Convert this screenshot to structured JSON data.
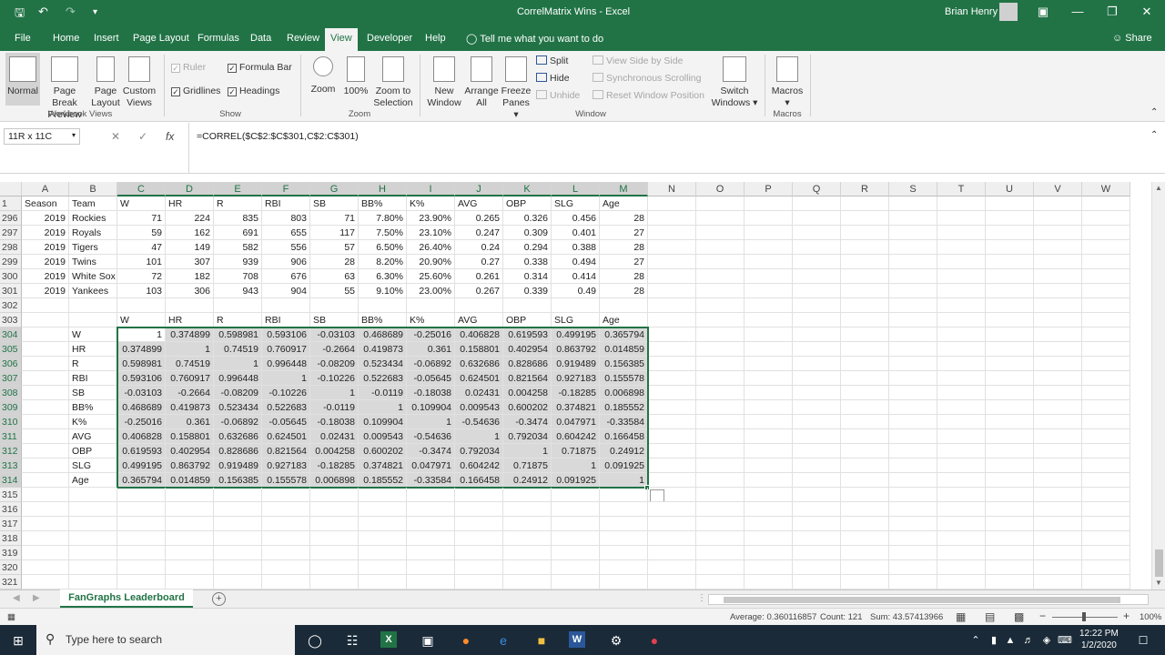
{
  "window": {
    "title": "CorrelMatrix Wins  -  Excel",
    "user": "Brian Henry"
  },
  "tabs": [
    "File",
    "Home",
    "Insert",
    "Page Layout",
    "Formulas",
    "Data",
    "Review",
    "View",
    "Developer",
    "Help"
  ],
  "active_tab": "View",
  "tell_me": "Tell me what you want to do",
  "share": "Share",
  "ribbon": {
    "workbook_views": {
      "group": "Workbook Views",
      "normal": "Normal",
      "page_break": "Page Break Preview",
      "page_layout": "Page Layout",
      "custom_views": "Custom Views"
    },
    "show": {
      "group": "Show",
      "ruler": "Ruler",
      "formula_bar": "Formula Bar",
      "gridlines": "Gridlines",
      "headings": "Headings"
    },
    "zoom": {
      "group": "Zoom",
      "zoom": "Zoom",
      "hundred": "100%",
      "zoom_sel": "Zoom to Selection"
    },
    "window": {
      "group": "Window",
      "new_window": "New Window",
      "arrange_all": "Arrange All",
      "freeze_panes": "Freeze Panes",
      "split": "Split",
      "hide": "Hide",
      "unhide": "Unhide",
      "side_by_side": "View Side by Side",
      "sync_scroll": "Synchronous Scrolling",
      "reset_pos": "Reset Window Position",
      "switch_windows": "Switch Windows"
    },
    "macros": {
      "group": "Macros",
      "macros": "Macros"
    }
  },
  "formula_bar": {
    "name_box": "11R x 11C",
    "formula": "=CORREL($C$2:$C$301,C$2:C$301)"
  },
  "columns": [
    "A",
    "B",
    "C",
    "D",
    "E",
    "F",
    "G",
    "H",
    "I",
    "J",
    "K",
    "L",
    "M",
    "N",
    "O",
    "P",
    "Q",
    "R",
    "S",
    "T",
    "U",
    "V",
    "W"
  ],
  "header_row": {
    "num": "1",
    "cells": [
      "Season",
      "Team",
      "W",
      "HR",
      "R",
      "RBI",
      "SB",
      "BB%",
      "K%",
      "AVG",
      "OBP",
      "SLG",
      "Age"
    ]
  },
  "data_rows": [
    {
      "num": "296",
      "cells": [
        "2019",
        "Rockies",
        "71",
        "224",
        "835",
        "803",
        "71",
        "7.80%",
        "23.90%",
        "0.265",
        "0.326",
        "0.456",
        "28"
      ]
    },
    {
      "num": "297",
      "cells": [
        "2019",
        "Royals",
        "59",
        "162",
        "691",
        "655",
        "117",
        "7.50%",
        "23.10%",
        "0.247",
        "0.309",
        "0.401",
        "27"
      ]
    },
    {
      "num": "298",
      "cells": [
        "2019",
        "Tigers",
        "47",
        "149",
        "582",
        "556",
        "57",
        "6.50%",
        "26.40%",
        "0.24",
        "0.294",
        "0.388",
        "28"
      ]
    },
    {
      "num": "299",
      "cells": [
        "2019",
        "Twins",
        "101",
        "307",
        "939",
        "906",
        "28",
        "8.20%",
        "20.90%",
        "0.27",
        "0.338",
        "0.494",
        "27"
      ]
    },
    {
      "num": "300",
      "cells": [
        "2019",
        "White Sox",
        "72",
        "182",
        "708",
        "676",
        "63",
        "6.30%",
        "25.60%",
        "0.261",
        "0.314",
        "0.414",
        "28"
      ]
    },
    {
      "num": "301",
      "cells": [
        "2019",
        "Yankees",
        "103",
        "306",
        "943",
        "904",
        "55",
        "9.10%",
        "23.00%",
        "0.267",
        "0.339",
        "0.49",
        "28"
      ]
    }
  ],
  "blank_row_302": "302",
  "matrix_header_row": {
    "num": "303",
    "cells": [
      "",
      "",
      "W",
      "HR",
      "R",
      "RBI",
      "SB",
      "BB%",
      "K%",
      "AVG",
      "OBP",
      "SLG",
      "Age"
    ]
  },
  "matrix_rows": [
    {
      "num": "304",
      "label": "W",
      "values": [
        "1",
        "0.374899",
        "0.598981",
        "0.593106",
        "-0.03103",
        "0.468689",
        "-0.25016",
        "0.406828",
        "0.619593",
        "0.499195",
        "0.365794"
      ]
    },
    {
      "num": "305",
      "label": "HR",
      "values": [
        "0.374899",
        "1",
        "0.74519",
        "0.760917",
        "-0.2664",
        "0.419873",
        "0.361",
        "0.158801",
        "0.402954",
        "0.863792",
        "0.014859"
      ]
    },
    {
      "num": "306",
      "label": "R",
      "values": [
        "0.598981",
        "0.74519",
        "1",
        "0.996448",
        "-0.08209",
        "0.523434",
        "-0.06892",
        "0.632686",
        "0.828686",
        "0.919489",
        "0.156385"
      ]
    },
    {
      "num": "307",
      "label": "RBI",
      "values": [
        "0.593106",
        "0.760917",
        "0.996448",
        "1",
        "-0.10226",
        "0.522683",
        "-0.05645",
        "0.624501",
        "0.821564",
        "0.927183",
        "0.155578"
      ]
    },
    {
      "num": "308",
      "label": "SB",
      "values": [
        "-0.03103",
        "-0.2664",
        "-0.08209",
        "-0.10226",
        "1",
        "-0.0119",
        "-0.18038",
        "0.02431",
        "0.004258",
        "-0.18285",
        "0.006898"
      ]
    },
    {
      "num": "309",
      "label": "BB%",
      "values": [
        "0.468689",
        "0.419873",
        "0.523434",
        "0.522683",
        "-0.0119",
        "1",
        "0.109904",
        "0.009543",
        "0.600202",
        "0.374821",
        "0.185552"
      ]
    },
    {
      "num": "310",
      "label": "K%",
      "values": [
        "-0.25016",
        "0.361",
        "-0.06892",
        "-0.05645",
        "-0.18038",
        "0.109904",
        "1",
        "-0.54636",
        "-0.3474",
        "0.047971",
        "-0.33584"
      ]
    },
    {
      "num": "311",
      "label": "AVG",
      "values": [
        "0.406828",
        "0.158801",
        "0.632686",
        "0.624501",
        "0.02431",
        "0.009543",
        "-0.54636",
        "1",
        "0.792034",
        "0.604242",
        "0.166458"
      ]
    },
    {
      "num": "312",
      "label": "OBP",
      "values": [
        "0.619593",
        "0.402954",
        "0.828686",
        "0.821564",
        "0.004258",
        "0.600202",
        "-0.3474",
        "0.792034",
        "1",
        "0.71875",
        "0.24912"
      ]
    },
    {
      "num": "313",
      "label": "SLG",
      "values": [
        "0.499195",
        "0.863792",
        "0.919489",
        "0.927183",
        "-0.18285",
        "0.374821",
        "0.047971",
        "0.604242",
        "0.71875",
        "1",
        "0.091925"
      ]
    },
    {
      "num": "314",
      "label": "Age",
      "values": [
        "0.365794",
        "0.014859",
        "0.156385",
        "0.155578",
        "0.006898",
        "0.185552",
        "-0.33584",
        "0.166458",
        "0.24912",
        "0.091925",
        "1"
      ]
    }
  ],
  "empty_rows": [
    "315",
    "316",
    "317",
    "318",
    "319",
    "320",
    "321"
  ],
  "sheet_tab": "FanGraphs Leaderboard",
  "status": {
    "average": "Average: 0.360116857",
    "count": "Count: 121",
    "sum": "Sum: 43.57413966",
    "zoom": "100%"
  },
  "taskbar": {
    "search_placeholder": "Type here to search",
    "time": "12:22 PM",
    "date": "1/2/2020"
  },
  "colors": {
    "excel_green": "#217346",
    "selection": "#d9d9d9"
  }
}
